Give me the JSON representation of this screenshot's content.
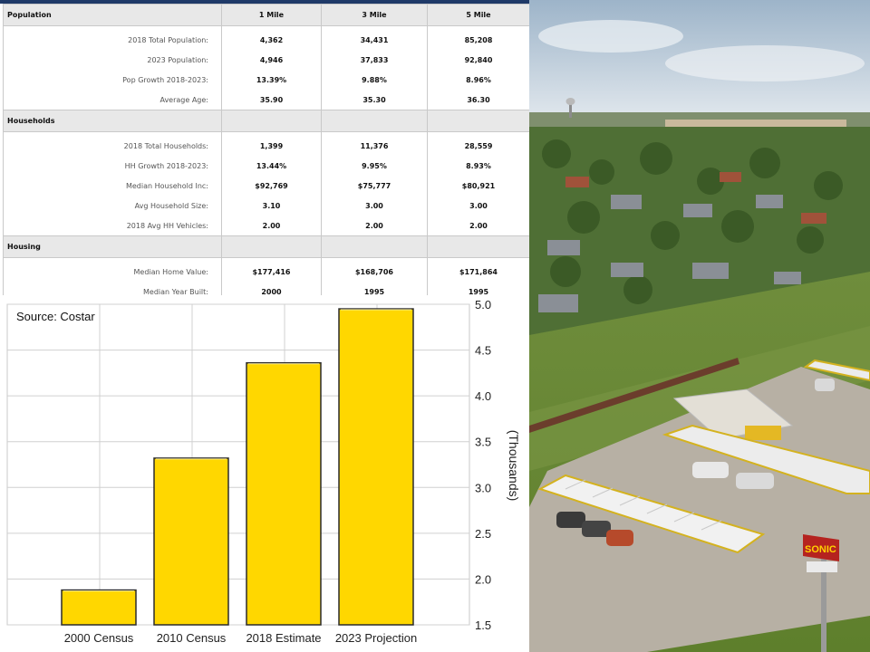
{
  "demographics": {
    "columns": [
      "Population",
      "1 Mile",
      "3 Mile",
      "5 Mile"
    ],
    "sections": [
      {
        "title": "Population",
        "header_values": [
          "1 Mile",
          "3 Mile",
          "5 Mile"
        ],
        "rows": [
          {
            "label": "2018 Total Population:",
            "values": [
              "4,362",
              "34,431",
              "85,208"
            ]
          },
          {
            "label": "2023 Population:",
            "values": [
              "4,946",
              "37,833",
              "92,840"
            ]
          },
          {
            "label": "Pop Growth 2018-2023:",
            "values": [
              "13.39%",
              "9.88%",
              "8.96%"
            ]
          },
          {
            "label": "Average Age:",
            "values": [
              "35.90",
              "35.30",
              "36.30"
            ]
          }
        ]
      },
      {
        "title": "Households",
        "rows": [
          {
            "label": "2018 Total Households:",
            "values": [
              "1,399",
              "11,376",
              "28,559"
            ]
          },
          {
            "label": "HH Growth 2018-2023:",
            "values": [
              "13.44%",
              "9.95%",
              "8.93%"
            ]
          },
          {
            "label": "Median Household Inc:",
            "values": [
              "$92,769",
              "$75,777",
              "$80,921"
            ]
          },
          {
            "label": "Avg Household Size:",
            "values": [
              "3.10",
              "3.00",
              "3.00"
            ]
          },
          {
            "label": "2018 Avg HH Vehicles:",
            "values": [
              "2.00",
              "2.00",
              "2.00"
            ]
          }
        ]
      },
      {
        "title": "Housing",
        "rows": [
          {
            "label": "Median Home Value:",
            "values": [
              "$177,416",
              "$168,706",
              "$171,864"
            ]
          },
          {
            "label": "Median Year Built:",
            "values": [
              "2000",
              "1995",
              "1995"
            ]
          }
        ]
      }
    ]
  },
  "chart_data": {
    "type": "bar",
    "source_note": "Source: Costar",
    "categories": [
      "2000 Census",
      "2010 Census",
      "2018 Estimate",
      "2023 Projection"
    ],
    "values": [
      1.88,
      3.32,
      4.36,
      4.95
    ],
    "ylabel": "(Thousands)",
    "ylim": [
      1.5,
      5.0
    ],
    "yticks": [
      "5.0",
      "4.5",
      "4.0",
      "3.5",
      "3.0",
      "2.5",
      "2.0",
      "1.5"
    ],
    "y_axis_side": "right",
    "grid": true,
    "bar_color": "#ffd700",
    "bar_edge_color": "#2b2b2b"
  },
  "photo": {
    "description_icon": "aerial-photo-icon",
    "sign_text": "SONIC"
  }
}
